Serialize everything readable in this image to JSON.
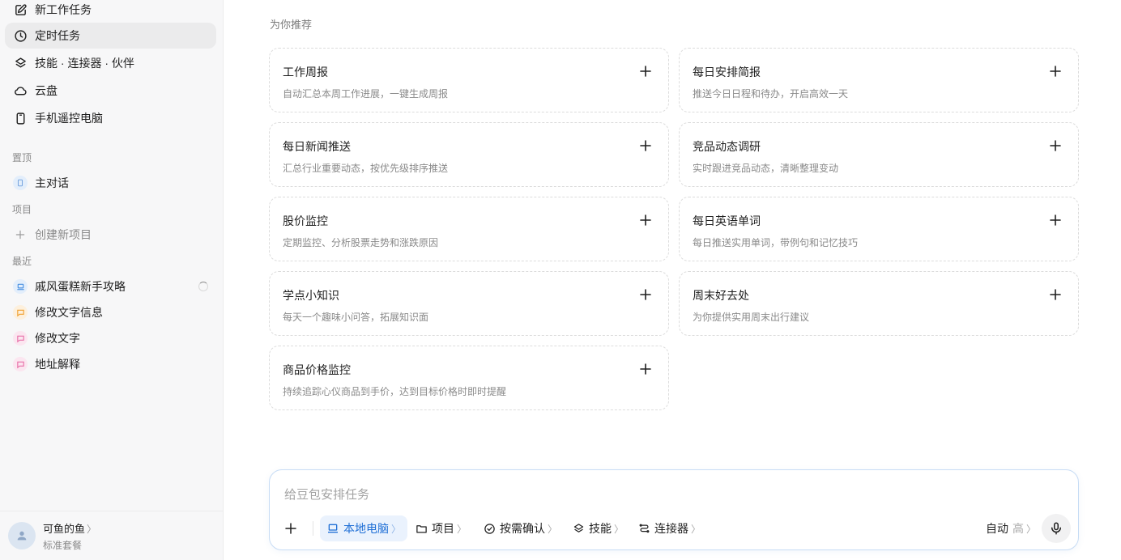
{
  "sidebar": {
    "nav": [
      {
        "label": "新工作任务",
        "icon": "edit-icon"
      },
      {
        "label": "定时任务",
        "icon": "clock-icon"
      },
      {
        "label": "技能 · 连接器 · 伙伴",
        "icon": "layers-icon"
      },
      {
        "label": "云盘",
        "icon": "cloud-icon"
      },
      {
        "label": "手机遥控电脑",
        "icon": "phone-icon"
      }
    ],
    "pinned_title": "置顶",
    "pinned": [
      {
        "label": "主对话"
      }
    ],
    "projects_title": "项目",
    "create_project": "创建新项目",
    "recent_title": "最近",
    "recent": [
      {
        "label": "戚风蛋糕新手攻略",
        "color": "#4a90e2"
      },
      {
        "label": "修改文字信息",
        "color": "#f0a030"
      },
      {
        "label": "修改文字",
        "color": "#e870a8"
      },
      {
        "label": "地址解释",
        "color": "#e870a8"
      }
    ],
    "user": {
      "name": "可鱼的鱼",
      "chevron": "〉",
      "plan": "标准套餐"
    }
  },
  "main": {
    "recommend_title": "为你推荐",
    "cards": [
      {
        "title": "工作周报",
        "desc": "自动汇总本周工作进展，一键生成周报"
      },
      {
        "title": "每日安排简报",
        "desc": "推送今日日程和待办，开启高效一天"
      },
      {
        "title": "每日新闻推送",
        "desc": "汇总行业重要动态，按优先级排序推送"
      },
      {
        "title": "竞品动态调研",
        "desc": "实时跟进竞品动态，清晰整理变动"
      },
      {
        "title": "股价监控",
        "desc": "定期监控、分析股票走势和涨跌原因"
      },
      {
        "title": "每日英语单词",
        "desc": "每日推送实用单词，带例句和记忆技巧"
      },
      {
        "title": "学点小知识",
        "desc": "每天一个趣味小问答，拓展知识面"
      },
      {
        "title": "周末好去处",
        "desc": "为你提供实用周末出行建议"
      },
      {
        "title": "商品价格监控",
        "desc": "持续追踪心仪商品到手价，达到目标价格时即时提醒"
      }
    ]
  },
  "composer": {
    "placeholder": "给豆包安排任务",
    "local": "本地电脑",
    "project": "项目",
    "confirm": "按需确认",
    "skills": "技能",
    "connectors": "连接器",
    "mode": "自动",
    "level": "高",
    "chevron": "〉"
  },
  "colors": {
    "accent": "#1f6fd6",
    "sidebar_bg": "#f7f7f8"
  }
}
